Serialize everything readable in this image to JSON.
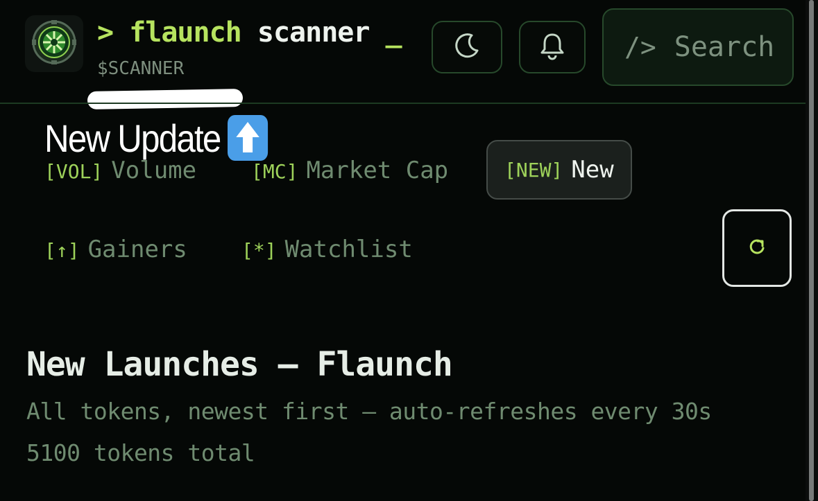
{
  "header": {
    "brand": {
      "prompt": ">",
      "name_part1": "flaunch",
      "name_part2": "scanner",
      "cursor": "_",
      "ticker": "$SCANNER",
      "logo_icon": "compass-emblem-icon"
    },
    "buttons": {
      "theme_icon": "moon-icon",
      "notifications_icon": "bell-icon",
      "search_prompt": "/>",
      "search_label": "Search"
    }
  },
  "annotation": {
    "text": "New Update",
    "emoji": "up-arrow-emoji"
  },
  "tabs": [
    {
      "tag": "[VOL]",
      "label": "Volume",
      "active": false
    },
    {
      "tag": "[MC]",
      "label": "Market Cap",
      "active": false
    },
    {
      "tag": "[NEW]",
      "label": "New",
      "active": true
    },
    {
      "tag": "[↑]",
      "label": "Gainers",
      "active": false
    },
    {
      "tag": "[*]",
      "label": "Watchlist",
      "active": false
    }
  ],
  "refresh": {
    "icon": "refresh-icon",
    "glyph": "↻"
  },
  "main": {
    "title": "New Launches — Flaunch",
    "subtitle": "All tokens, newest first — auto-refreshes every 30s",
    "count_text": "5100 tokens total"
  },
  "colors": {
    "background": "#050806",
    "accent_green": "#b6e35f",
    "muted_green": "#6f8b70",
    "border_green": "#27492b",
    "text_light": "#eef3ee"
  }
}
